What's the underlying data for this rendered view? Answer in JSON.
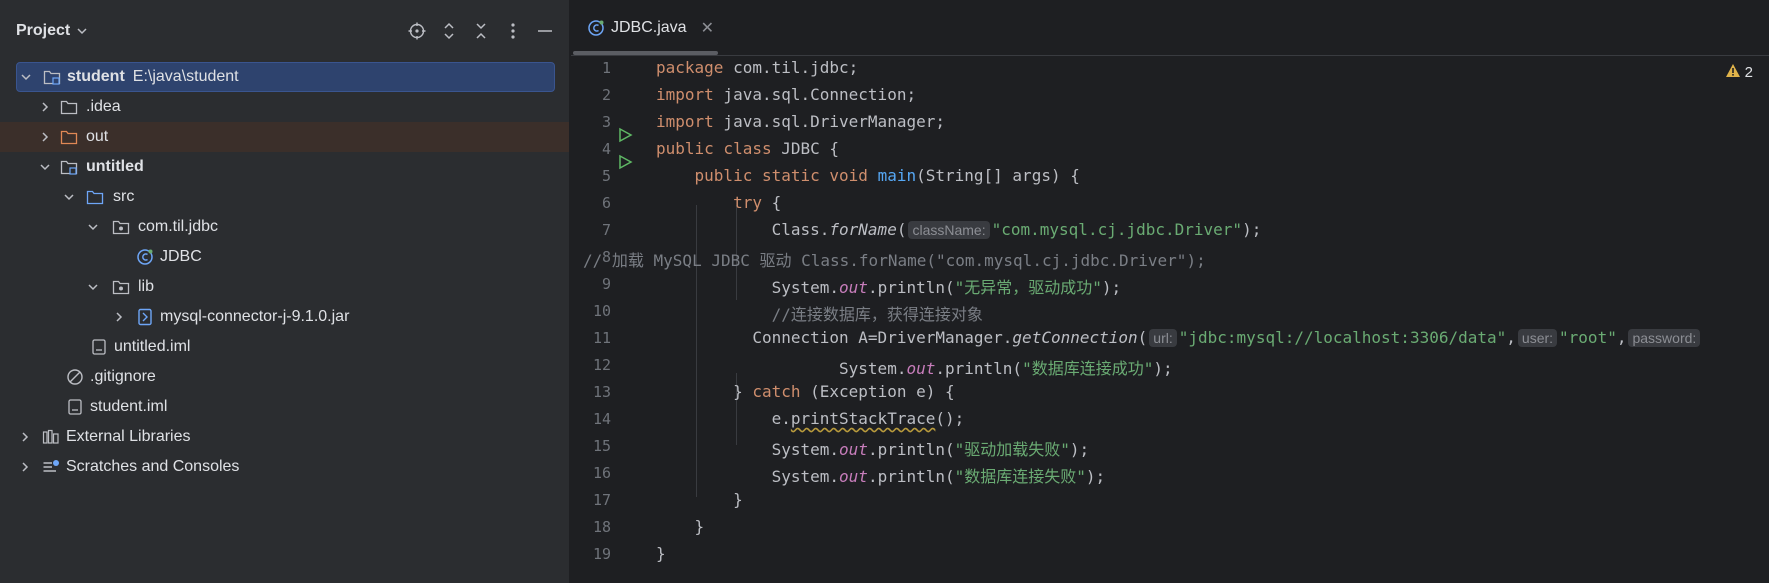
{
  "project_panel": {
    "title": "Project",
    "tree": [
      {
        "label": "student",
        "path": "E:\\java\\student",
        "bold": true
      },
      {
        "label": ".idea"
      },
      {
        "label": "out"
      },
      {
        "label": "untitled",
        "bold": true
      },
      {
        "label": "src"
      },
      {
        "label": "com.til.jdbc"
      },
      {
        "label": "JDBC"
      },
      {
        "label": "lib"
      },
      {
        "label": "mysql-connector-j-9.1.0.jar"
      },
      {
        "label": "untitled.iml"
      },
      {
        "label": ".gitignore"
      },
      {
        "label": "student.iml"
      },
      {
        "label": "External Libraries"
      },
      {
        "label": "Scratches and Consoles"
      }
    ]
  },
  "editor": {
    "tab_label": "JDBC.java",
    "warning_count": "2",
    "line_numbers": [
      "1",
      "2",
      "3",
      "4",
      "5",
      "6",
      "7",
      "8",
      "9",
      "10",
      "11",
      "12",
      "13",
      "14",
      "15",
      "16",
      "17",
      "18",
      "19"
    ],
    "code": {
      "l1": [
        "package",
        " com.til.jdbc;"
      ],
      "l2": [
        "import",
        " java.sql.Connection;"
      ],
      "l3": [
        "import",
        " java.sql.DriverManager;"
      ],
      "l4": [
        "public class",
        " JDBC {"
      ],
      "l5": [
        "    ",
        "public static void",
        " ",
        "main",
        "(String[] args) {"
      ],
      "l6": [
        "        ",
        "try",
        " {"
      ],
      "l7": [
        "            Class.",
        "forName",
        "(",
        "className:",
        "\"com.mysql.cj.jdbc.Driver\"",
        ");"
      ],
      "l8": "// 加载 MySQL JDBC 驱动 Class.forName(\"com.mysql.cj.jdbc.Driver\");",
      "l9": [
        "            System.",
        "out",
        ".println(",
        "\"无异常，驱动成功\"",
        ");"
      ],
      "l10": "            //连接数据库，获得连接对象",
      "l11": [
        "          Connection A=DriverManager.",
        "getConnection",
        "(",
        "url:",
        "\"jdbc:mysql://localhost:3306/data\"",
        ",",
        "user:",
        "\"root\"",
        ",",
        "password:"
      ],
      "l12": [
        "                   System.",
        "out",
        ".println(",
        "\"数据库连接成功\"",
        ");"
      ],
      "l13": [
        "        } ",
        "catch",
        " (Exception e) {"
      ],
      "l14": [
        "            e.",
        "printStackTrace",
        "();"
      ],
      "l15": [
        "            System.",
        "out",
        ".println(",
        "\"驱动加载失败\"",
        ");"
      ],
      "l16": [
        "            System.",
        "out",
        ".println(",
        "\"数据库连接失败\"",
        ");"
      ],
      "l17": "        }",
      "l18": "    }",
      "l19": "}"
    }
  }
}
